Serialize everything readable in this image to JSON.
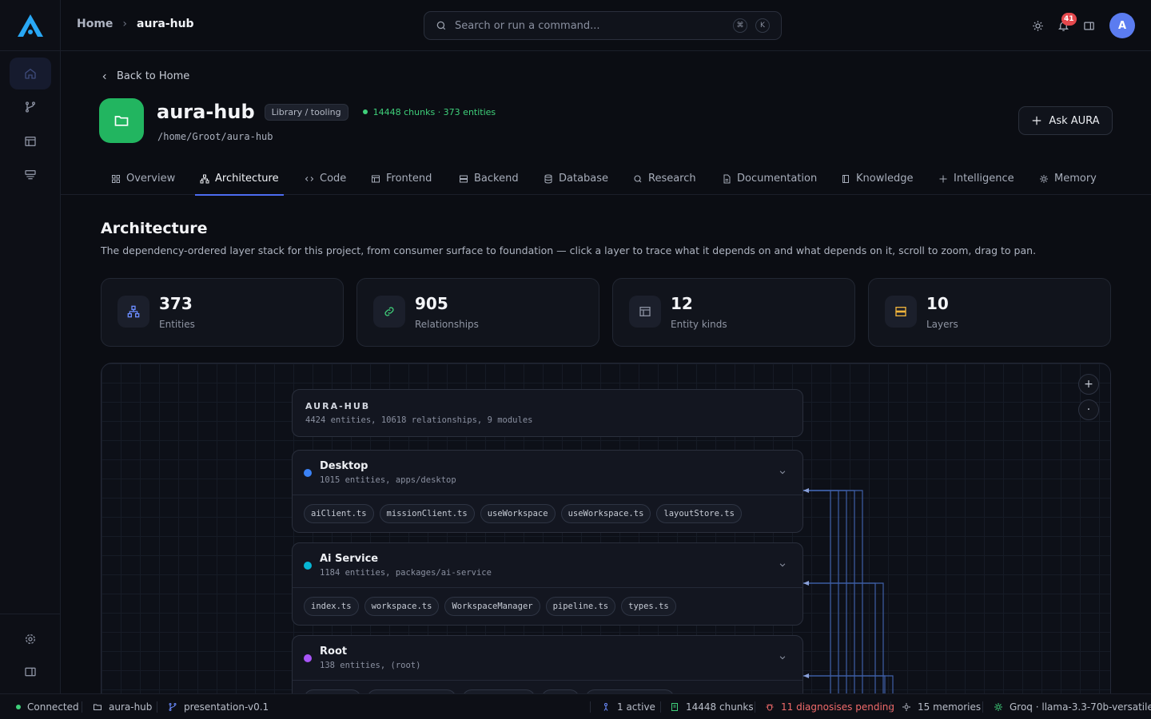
{
  "sidebar": {
    "items": [
      {
        "name": "home",
        "icon": "home-icon"
      },
      {
        "name": "git",
        "icon": "git-branch-icon"
      },
      {
        "name": "layout",
        "icon": "layout-icon"
      },
      {
        "name": "server",
        "icon": "server-icon"
      }
    ],
    "bottom": [
      {
        "name": "settings",
        "icon": "gear-icon"
      },
      {
        "name": "panel",
        "icon": "panel-icon"
      }
    ]
  },
  "topbar": {
    "breadcrumb_home": "Home",
    "breadcrumb_current": "aura-hub",
    "search_placeholder": "Search or run a command...",
    "kbd_1": "⌘",
    "kbd_2": "K",
    "notification_count": "41",
    "avatar_initial": "A"
  },
  "project": {
    "back_label": "Back to Home",
    "name": "aura-hub",
    "tag": "Library / tooling",
    "status": "14448 chunks · 373 entities",
    "path": "/home/Groot/aura-hub",
    "ask_label": "Ask AURA"
  },
  "tabs": [
    {
      "label": "Overview",
      "icon": "grid-icon"
    },
    {
      "label": "Architecture",
      "icon": "hierarchy-icon",
      "active": true
    },
    {
      "label": "Code",
      "icon": "code-icon"
    },
    {
      "label": "Frontend",
      "icon": "layout-icon"
    },
    {
      "label": "Backend",
      "icon": "server-icon"
    },
    {
      "label": "Database",
      "icon": "database-icon"
    },
    {
      "label": "Research",
      "icon": "search-icon"
    },
    {
      "label": "Documentation",
      "icon": "document-icon"
    },
    {
      "label": "Knowledge",
      "icon": "book-icon"
    },
    {
      "label": "Intelligence",
      "icon": "sparkle-icon"
    },
    {
      "label": "Memory",
      "icon": "chip-icon"
    }
  ],
  "section": {
    "title": "Architecture",
    "description": "The dependency-ordered layer stack for this project, from consumer surface to foundation — click a layer to trace what it depends on and what depends on it, scroll to zoom, drag to pan."
  },
  "stats": [
    {
      "value": "373",
      "label": "Entities",
      "icon": "hierarchy-icon",
      "color": "#6b8cff"
    },
    {
      "value": "905",
      "label": "Relationships",
      "icon": "link-icon",
      "color": "#3fd07a"
    },
    {
      "value": "12",
      "label": "Entity kinds",
      "icon": "layout-icon",
      "color": "#8a90a0"
    },
    {
      "value": "10",
      "label": "Layers",
      "icon": "server-icon",
      "color": "#f0b43c"
    }
  ],
  "graph": {
    "root_title": "AURA-HUB",
    "root_summary": "4424 entities, 10618 relationships, 9 modules",
    "zoom_in": "+",
    "zoom_reset": "·",
    "layers": [
      {
        "name": "Desktop",
        "summary": "1015 entities, apps/desktop",
        "color": "#3b82f6",
        "chips": [
          "aiClient.ts",
          "missionClient.ts",
          "useWorkspace",
          "useWorkspace.ts",
          "layoutStore.ts"
        ]
      },
      {
        "name": "Ai Service",
        "summary": "1184 entities, packages/ai-service",
        "color": "#06b6d4",
        "chips": [
          "index.ts",
          "workspace.ts",
          "WorkspaceManager",
          "pipeline.ts",
          "types.ts"
        ]
      },
      {
        "name": "Root",
        "summary": "138 entities, (root)",
        "color": "#a855f7",
        "chips": []
      }
    ]
  },
  "statusbar": {
    "connected": "Connected",
    "project": "aura-hub",
    "branch": "presentation-v0.1",
    "active": "1 active",
    "chunks": "14448 chunks",
    "diagnoses": "11 diagnosises pending",
    "memories": "15 memories",
    "model": "Groq · llama-3.3-70b-versatile"
  },
  "colors": {
    "accent": "#4d6cf0",
    "success": "#3fd07a",
    "danger": "#e5484d",
    "logo": "#29a8f5"
  }
}
